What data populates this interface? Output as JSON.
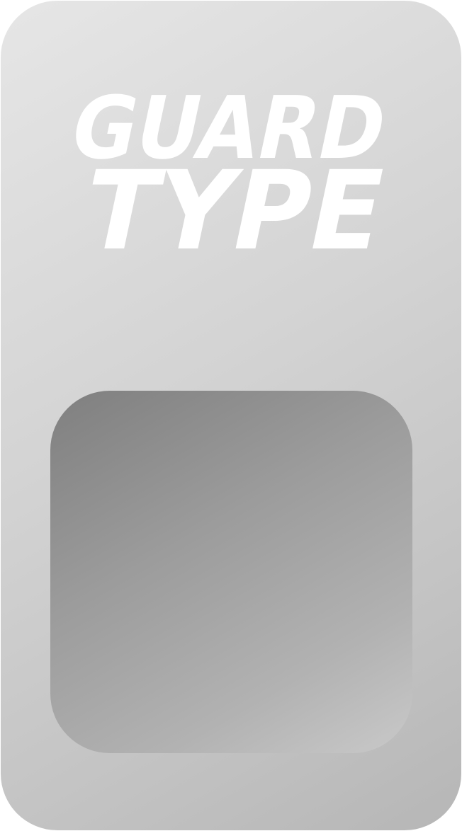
{
  "logo": {
    "line1": "GUARD",
    "line2": "TYPE"
  },
  "colors": {
    "card_light": "#e6e6e6",
    "card_dark": "#b6b6b6",
    "window_dark": "#7f7f7f",
    "window_light": "#c9c9c9",
    "logo_text": "#ffffff"
  }
}
